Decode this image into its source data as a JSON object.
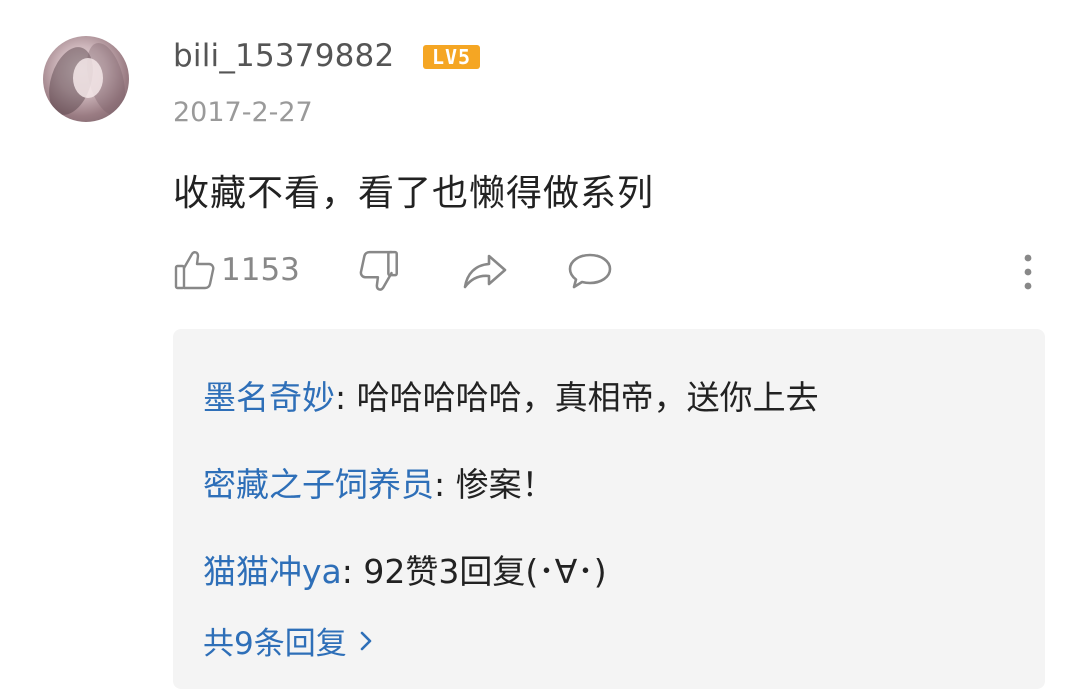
{
  "comment": {
    "username": "bili_15379882",
    "level_badge": "LV5",
    "date": "2017-2-27",
    "text": "收藏不看，看了也懒得做系列",
    "like_count": "1153"
  },
  "icons": {
    "like": "thumbs-up-icon",
    "dislike": "thumbs-down-icon",
    "share": "share-icon",
    "reply": "comment-bubble-icon",
    "more": "more-vertical-icon",
    "view_all": "chevron-right-icon"
  },
  "replies": [
    {
      "author": "墨名奇妙",
      "separator": ": ",
      "text": "哈哈哈哈哈，真相帝，送你上去"
    },
    {
      "author": "密藏之子饲养员",
      "separator": ": ",
      "text": "惨案！"
    },
    {
      "author": "猫猫冲ya",
      "separator": ": ",
      "text": "92赞3回复(･∀･)"
    }
  ],
  "view_all_label": "共9条回复",
  "colors": {
    "link": "#2e6fb8",
    "badge": "#f5a623",
    "muted": "#9a9a9a",
    "reply_bg": "#f4f4f4"
  }
}
